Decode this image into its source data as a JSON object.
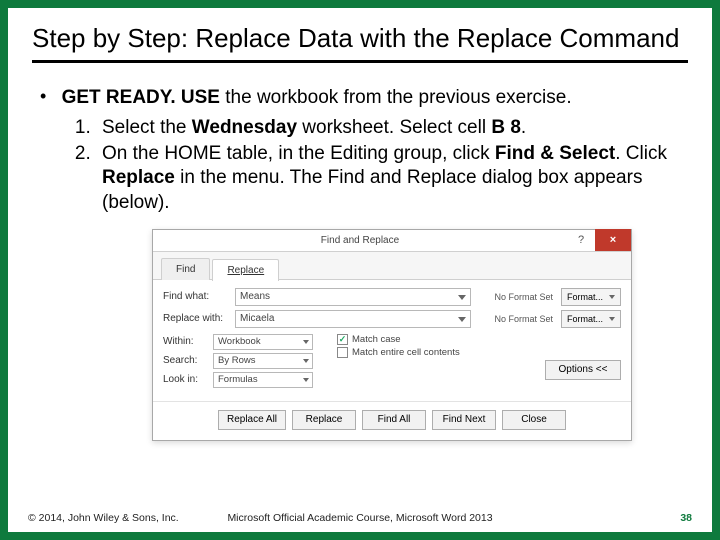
{
  "title": "Step by Step: Replace Data with the Replace Command",
  "intro": {
    "lead": "GET READY. USE",
    "tail": " the workbook from the previous exercise."
  },
  "steps": {
    "s1a": "Select the ",
    "s1b": "Wednesday",
    "s1c": " worksheet. Select cell ",
    "s1d": "B 8",
    "s1e": ".",
    "s2a": "On the HOME table, in the Editing group, click ",
    "s2b": "Find & Select",
    "s2c": ". Click ",
    "s2d": "Replace",
    "s2e": " in the menu. The Find and Replace dialog box appears (below)."
  },
  "dialog": {
    "title": "Find and Replace",
    "tabs": {
      "find": "Find",
      "replace": "Replace"
    },
    "labels": {
      "findWhat": "Find what:",
      "replaceWith": "Replace with:",
      "within": "Within:",
      "search": "Search:",
      "lookIn": "Look in:",
      "noFormat": "No Format Set",
      "format": "Format...",
      "matchCase": "Match case",
      "matchEntire": "Match entire cell contents",
      "options": "Options <<"
    },
    "values": {
      "findWhat": "Means",
      "replaceWith": "Micaela",
      "within": "Workbook",
      "search": "By Rows",
      "lookIn": "Formulas"
    },
    "buttons": {
      "replaceAll": "Replace All",
      "replace": "Replace",
      "findAll": "Find All",
      "findNext": "Find Next",
      "close": "Close"
    }
  },
  "footer": {
    "left": "© 2014, John Wiley & Sons, Inc.",
    "mid": "Microsoft Official Academic Course, Microsoft Word 2013",
    "right": "38"
  }
}
